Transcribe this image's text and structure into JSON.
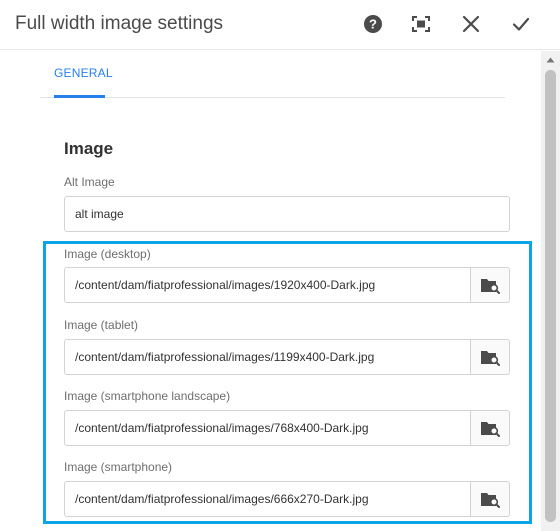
{
  "dialog": {
    "title": "Full width image settings",
    "toolbar": {
      "help_icon": "help-circle-icon",
      "fullscreen_icon": "fullscreen-icon",
      "close_icon": "close-icon",
      "done_icon": "checkmark-icon"
    }
  },
  "tabs": [
    {
      "label": "GENERAL",
      "selected": true
    }
  ],
  "section": {
    "heading": "Image"
  },
  "fields": {
    "alt_image": {
      "label": "Alt Image",
      "value": "alt image"
    },
    "image_desktop": {
      "label": "Image (desktop)",
      "value": "/content/dam/fiatprofessional/images/1920x400-Dark.jpg"
    },
    "image_tablet": {
      "label": "Image (tablet)",
      "value": "/content/dam/fiatprofessional/images/1199x400-Dark.jpg"
    },
    "image_smartphone_landscape": {
      "label": "Image (smartphone landscape)",
      "value": "/content/dam/fiatprofessional/images/768x400-Dark.jpg"
    },
    "image_smartphone": {
      "label": "Image (smartphone)",
      "value": "/content/dam/fiatprofessional/images/666x270-Dark.jpg"
    }
  },
  "colors": {
    "accent": "#2680eb",
    "highlight": "#0ba4e8",
    "text": "#4b4b4b"
  },
  "icons": {
    "browse": "folder-search-icon"
  }
}
